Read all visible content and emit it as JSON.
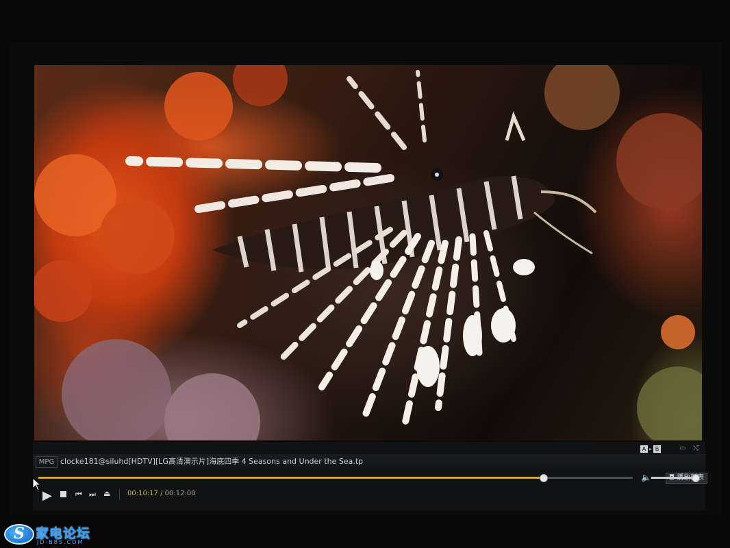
{
  "player": {
    "format_badge": "MPG",
    "file_title": "clocke181@siluhd[HDTV][LG高清演示片]海底四季  4 Seasons and Under the Sea.tp",
    "ab_repeat": {
      "a_label": "A",
      "b_label": "B"
    },
    "playback": {
      "progress_fraction": 0.85,
      "volume_fraction": 0.96
    },
    "time": {
      "elapsed": "00:10:17",
      "separator": "/",
      "total": "00:12:00"
    },
    "playlist_label": "播放列表",
    "icons": {
      "play": "play-icon",
      "stop": "stop-icon",
      "previous": "skip-previous-icon",
      "next": "skip-next-icon",
      "eject": "eject-icon",
      "volume": "volume-icon",
      "window": "window-mode-icon",
      "shuffle": "shuffle-icon",
      "ab_arrow": "arrow-right-icon",
      "playlist": "playlist-icon"
    }
  },
  "video": {
    "description_icon": "video-frame"
  },
  "watermark": {
    "logo_text": "家电论坛",
    "logo_subtext": "JD-BBS.COM",
    "logo_mark": "S"
  },
  "colors": {
    "time_elapsed": "#c9b84a",
    "seek_fill": "#e0c040",
    "logo_blue": "#33a0ff"
  }
}
